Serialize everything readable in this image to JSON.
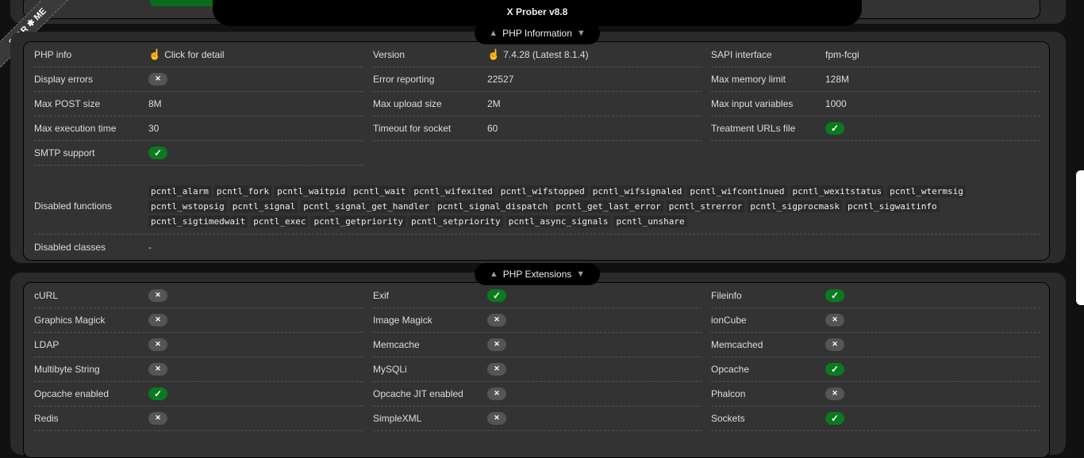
{
  "app": {
    "title": "X Prober v8.8",
    "ribbon": "STAR ✱ ME"
  },
  "php_info": {
    "title": "PHP Information",
    "rows": [
      {
        "label": "PHP info",
        "value": "Click for detail",
        "icon": "pointer-hand"
      },
      {
        "label": "Version",
        "value": "7.4.28 (Latest 8.1.4)",
        "icon": "pointer-hand"
      },
      {
        "label": "SAPI interface",
        "value": "fpm-fcgi"
      },
      {
        "label": "Display errors",
        "status": false
      },
      {
        "label": "Error reporting",
        "value": "22527"
      },
      {
        "label": "Max memory limit",
        "value": "128M"
      },
      {
        "label": "Max POST size",
        "value": "8M"
      },
      {
        "label": "Max upload size",
        "value": "2M"
      },
      {
        "label": "Max input variables",
        "value": "1000"
      },
      {
        "label": "Max execution time",
        "value": "30"
      },
      {
        "label": "Timeout for socket",
        "value": "60"
      },
      {
        "label": "Treatment URLs file",
        "status": true
      },
      {
        "label": "SMTP support",
        "status": true
      }
    ],
    "disabled_functions_label": "Disabled functions",
    "disabled_functions": [
      "pcntl_alarm",
      "pcntl_fork",
      "pcntl_waitpid",
      "pcntl_wait",
      "pcntl_wifexited",
      "pcntl_wifstopped",
      "pcntl_wifsignaled",
      "pcntl_wifcontinued",
      "pcntl_wexitstatus",
      "pcntl_wtermsig",
      "pcntl_wstopsig",
      "pcntl_signal",
      "pcntl_signal_get_handler",
      "pcntl_signal_dispatch",
      "pcntl_get_last_error",
      "pcntl_strerror",
      "pcntl_sigprocmask",
      "pcntl_sigwaitinfo",
      "pcntl_sigtimedwait",
      "pcntl_exec",
      "pcntl_getpriority",
      "pcntl_setpriority",
      "pcntl_async_signals",
      "pcntl_unshare"
    ],
    "disabled_classes_label": "Disabled classes",
    "disabled_classes_value": "-"
  },
  "php_extensions": {
    "title": "PHP Extensions",
    "rows": [
      {
        "label": "cURL",
        "status": false
      },
      {
        "label": "Exif",
        "status": true
      },
      {
        "label": "Fileinfo",
        "status": true
      },
      {
        "label": "Graphics Magick",
        "status": false
      },
      {
        "label": "Image Magick",
        "status": false
      },
      {
        "label": "ionCube",
        "status": false
      },
      {
        "label": "LDAP",
        "status": false
      },
      {
        "label": "Memcache",
        "status": false
      },
      {
        "label": "Memcached",
        "status": false
      },
      {
        "label": "Multibyte String",
        "status": false
      },
      {
        "label": "MySQLi",
        "status": false
      },
      {
        "label": "Opcache",
        "status": true
      },
      {
        "label": "Opcache enabled",
        "status": true
      },
      {
        "label": "Opcache JIT enabled",
        "status": false
      },
      {
        "label": "Phalcon",
        "status": false
      },
      {
        "label": "Redis",
        "status": false
      },
      {
        "label": "SimpleXML",
        "status": false
      },
      {
        "label": "Sockets",
        "status": true
      }
    ]
  },
  "colors": {
    "yes": "#0a7a1f",
    "no": "#555555",
    "bg": "#111111",
    "card": "#333333"
  }
}
